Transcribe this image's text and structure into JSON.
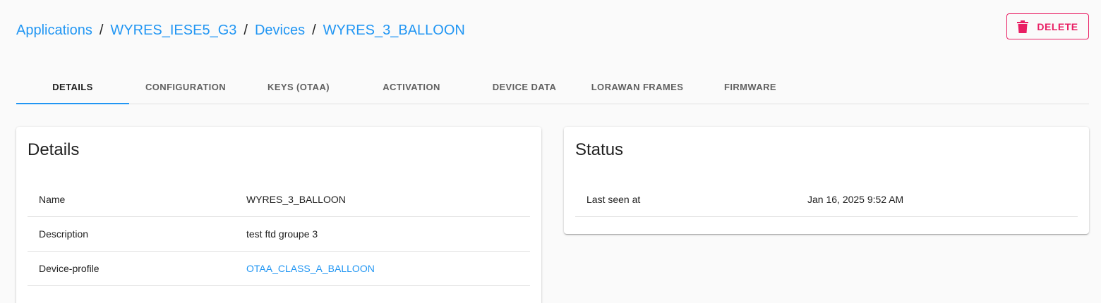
{
  "breadcrumb": {
    "items": [
      "Applications",
      "WYRES_IESE5_G3",
      "Devices",
      "WYRES_3_BALLOON"
    ],
    "separator": "/"
  },
  "actions": {
    "delete_label": "DELETE",
    "delete_icon": "trash-icon"
  },
  "tabs": [
    {
      "label": "DETAILS",
      "active": true
    },
    {
      "label": "CONFIGURATION",
      "active": false
    },
    {
      "label": "KEYS (OTAA)",
      "active": false
    },
    {
      "label": "ACTIVATION",
      "active": false
    },
    {
      "label": "DEVICE DATA",
      "active": false
    },
    {
      "label": "LORAWAN FRAMES",
      "active": false
    },
    {
      "label": "FIRMWARE",
      "active": false
    }
  ],
  "details_card": {
    "title": "Details",
    "rows": [
      {
        "label": "Name",
        "value": "WYRES_3_BALLOON"
      },
      {
        "label": "Description",
        "value": "test ftd groupe 3"
      },
      {
        "label": "Device-profile",
        "value": "OTAA_CLASS_A_BALLOON"
      }
    ]
  },
  "status_card": {
    "title": "Status",
    "rows": [
      {
        "label": "Last seen at",
        "value": "Jan 16, 2025 9:52 AM"
      }
    ]
  },
  "colors": {
    "accent": "#2196f3",
    "danger": "#e91e63",
    "background": "#fafafa"
  }
}
